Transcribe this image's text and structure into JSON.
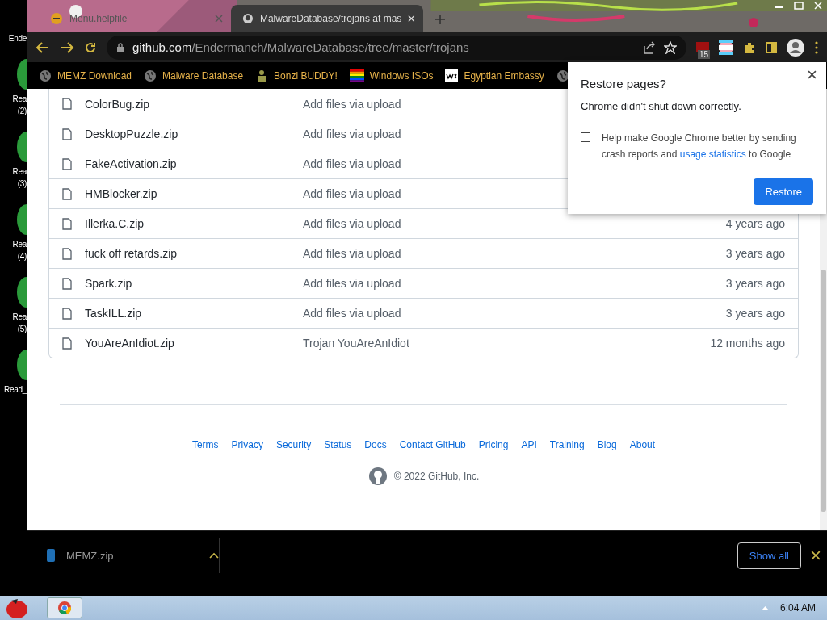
{
  "desktop_icons": [
    {
      "lines": [
        "Ende"
      ]
    },
    {
      "lines": [
        "Rea",
        "(2)"
      ]
    },
    {
      "lines": [
        "Rea",
        "(3)"
      ]
    },
    {
      "lines": [
        "Rea",
        "(4)"
      ]
    },
    {
      "lines": [
        "Rea",
        "(5)"
      ]
    },
    {
      "lines": [
        "Read_"
      ]
    }
  ],
  "tabs": [
    {
      "title": "Menu.helpfile",
      "selected": false
    },
    {
      "title": "MalwareDatabase/trojans at mas",
      "selected": true
    }
  ],
  "address": {
    "domain": "github.com",
    "path": "/Endermanch/MalwareDatabase/tree/master/trojans"
  },
  "extension_badge": "15",
  "bookmarks": [
    {
      "label": "MEMZ Download",
      "kind": "globe"
    },
    {
      "label": "Malware Database",
      "kind": "globe"
    },
    {
      "label": "Bonzi BUDDY!",
      "kind": "figure"
    },
    {
      "label": "Windows ISOs",
      "kind": "rainbow"
    },
    {
      "label": "Egyptian Embassy",
      "kind": "wix"
    },
    {
      "kind": "globe"
    }
  ],
  "files": [
    {
      "name": "ColorBug.zip",
      "message": "Add files via upload"
    },
    {
      "name": "DesktopPuzzle.zip",
      "message": "Add files via upload"
    },
    {
      "name": "FakeActivation.zip",
      "message": "Add files via upload"
    },
    {
      "name": "HMBlocker.zip",
      "message": "Add files via upload"
    },
    {
      "name": "Illerka.C.zip",
      "message": "Add files via upload",
      "time": "4 years ago"
    },
    {
      "name": "fuck off retards.zip",
      "message": "Add files via upload",
      "time": "3 years ago"
    },
    {
      "name": "Spark.zip",
      "message": "Add files via upload",
      "time": "3 years ago"
    },
    {
      "name": "TaskILL.zip",
      "message": "Add files via upload",
      "time": "3 years ago"
    },
    {
      "name": "YouAreAnIdiot.zip",
      "message": "Trojan YouAreAnIdiot",
      "time": "12 months ago"
    }
  ],
  "footer": {
    "links": [
      "Terms",
      "Privacy",
      "Security",
      "Status",
      "Docs",
      "Contact GitHub",
      "Pricing",
      "API",
      "Training",
      "Blog",
      "About"
    ],
    "copyright": "© 2022 GitHub, Inc."
  },
  "restore_dialog": {
    "title": "Restore pages?",
    "message": "Chrome didn't shut down correctly.",
    "consent_text": "Help make Google Chrome better by sending crash reports and ",
    "consent_link": "usage statistics",
    "consent_suffix": " to Google",
    "checked": false,
    "button": "Restore"
  },
  "downloads": {
    "items": [
      {
        "name": "MEMZ.zip"
      }
    ],
    "show_all": "Show all"
  },
  "taskbar": {
    "time": "6:04 AM"
  }
}
